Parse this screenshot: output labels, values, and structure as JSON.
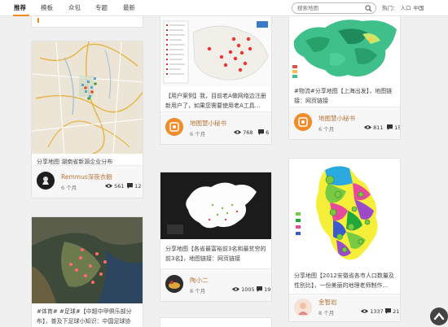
{
  "nav": {
    "tabs": [
      "推荐",
      "模板",
      "众包",
      "专题",
      "最新"
    ],
    "search_placeholder": "搜索地图",
    "hot_label": "热门：",
    "hot_links": [
      "人口",
      "中国"
    ]
  },
  "cards": {
    "c1": {
      "desc": "分享地图 湖南省新源企业分布",
      "author": "Remmus深夜衣橱",
      "age": "6 个月",
      "views": "561",
      "comments": "12"
    },
    "c2": {
      "desc": "#体育# #足球#【中超中甲俱乐部分布】，普及下足球小知识：中国足球协",
      "desc_line2": ""
    },
    "c3": {
      "desc": "【用户案例】我，目前老A做网络边注册新用户了，如果您需要使用老A工具...",
      "author": "地图慧小秘书",
      "age": "6 个月",
      "views": "768",
      "comments": "6"
    },
    "c4": {
      "desc": "分享地图【各省最富裕前3名和最贫穷的前3名】，地图链接：网页链接",
      "author": "陶小二",
      "age": "8 个月",
      "views": "1005",
      "comments": "19"
    },
    "c5": {
      "desc": "#物流#分享地图【上海出发】，地图链接：网页链接",
      "author": "地图慧小秘书",
      "age": "6 个月",
      "views": "811",
      "comments": "15"
    },
    "c6": {
      "desc": "分享地图【2012安徽省各市人口数量及性别比】，一份美丽的地理老师制作...",
      "author": "金智岩",
      "age": "8 个月",
      "views": "1337",
      "comments": "21"
    }
  },
  "colors": {
    "accent": "#f28b25",
    "author": "#b4743a",
    "map_green": "#2fb37a"
  }
}
